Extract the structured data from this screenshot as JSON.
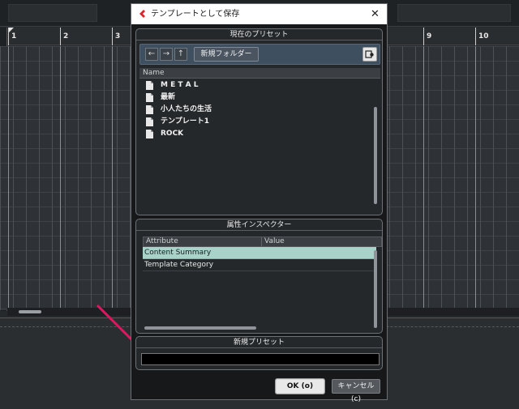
{
  "ruler": {
    "bars": [
      "1",
      "2",
      "3",
      "9",
      "10"
    ]
  },
  "dialog": {
    "title": "テンプレートとして保存",
    "close_glyph": "✕",
    "accent_color": "#d9262b",
    "current_presets": {
      "header": "現在のプリセット",
      "nav": {
        "back": "←",
        "forward": "→",
        "up": "↑"
      },
      "new_folder_label": "新規フォルダー",
      "settings_icon": "settings-icon",
      "column_name": "Name",
      "items": [
        {
          "label": "M E T A L",
          "icon": "document-icon"
        },
        {
          "label": "最新",
          "icon": "document-icon"
        },
        {
          "label": "小人たちの生活",
          "icon": "document-icon"
        },
        {
          "label": "テンプレート1",
          "icon": "document-icon"
        },
        {
          "label": "ROCK",
          "icon": "document-icon"
        }
      ]
    },
    "attribute_inspector": {
      "header": "属性インスペクター",
      "columns": {
        "attribute": "Attribute",
        "value": "Value"
      },
      "rows": [
        {
          "attribute": "Content Summary",
          "selected": true
        },
        {
          "attribute": "Template Category",
          "selected": false
        }
      ],
      "selected_row_color": "#a9d3c9"
    },
    "new_preset": {
      "header": "新規プリセット",
      "value": "",
      "placeholder": ""
    },
    "buttons": {
      "ok": "OK (o)",
      "cancel": "キャンセル (c)"
    }
  },
  "annotation": {
    "arrow_color": "#d81b60"
  }
}
